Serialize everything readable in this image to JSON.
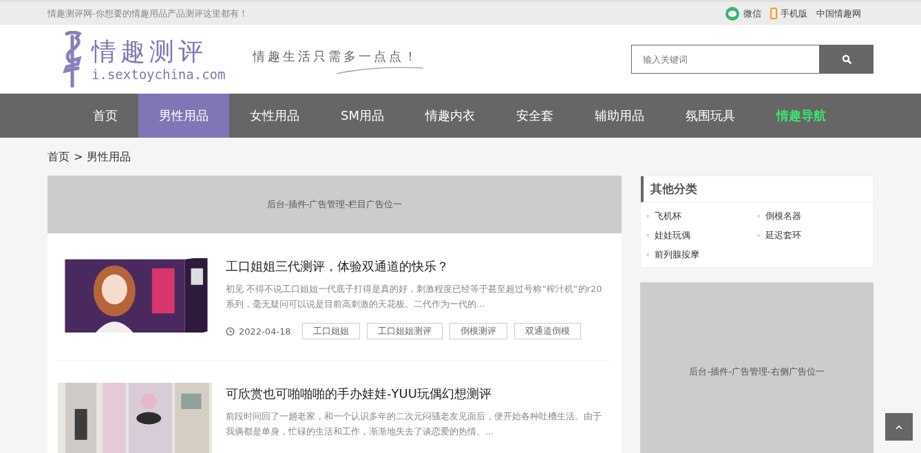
{
  "top_bar": {
    "tagline": "情趣测评网-你想要的情趣用品产品测评这里都有！",
    "links": [
      {
        "kind": "wechat",
        "label": "微信"
      },
      {
        "kind": "mobile",
        "label": "手机版"
      },
      {
        "kind": "plain",
        "label": "中国情趣网"
      }
    ]
  },
  "header": {
    "logo_title": "情趣测评",
    "logo_domain": "i.sextoychina.com",
    "slogan": "情趣生活只需多一点点！",
    "search": {
      "placeholder": "输入关键词"
    }
  },
  "nav": [
    {
      "label": "首页",
      "selected": false,
      "kind": "normal"
    },
    {
      "label": "男性用品",
      "selected": true,
      "kind": "normal"
    },
    {
      "label": "女性用品",
      "selected": false,
      "kind": "normal"
    },
    {
      "label": "SM用品",
      "selected": false,
      "kind": "normal"
    },
    {
      "label": "情趣内衣",
      "selected": false,
      "kind": "normal"
    },
    {
      "label": "安全套",
      "selected": false,
      "kind": "normal"
    },
    {
      "label": "辅助用品",
      "selected": false,
      "kind": "normal"
    },
    {
      "label": "氛围玩具",
      "selected": false,
      "kind": "normal"
    },
    {
      "label": "情趣导航",
      "selected": false,
      "kind": "highlight"
    }
  ],
  "breadcrumb": [
    "首页",
    "男性用品"
  ],
  "breadcrumb_separator": ">",
  "column_ad": "后台-插件-广告管理-栏目广告位一",
  "posts": [
    {
      "title": "工口姐姐三代测评，体验双通道的快乐？",
      "excerpt": "初见 不得不说工口姐姐一代底子打得是真的好，刺激程度已经等于甚至超过号称“榨汁机”的r20系列，毫无疑问可以说是目前高刺激的天花板。二代作为一代的...",
      "date": "2022-04-18",
      "tags": [
        "工口姐姐",
        "工口姐姐测评",
        "倒模测评",
        "双通道倒模"
      ]
    },
    {
      "title": "可欣赏也可啪啪啪的手办娃娃-YUU玩偶幻想测评",
      "excerpt": "前段时间回了一趟老家，和一个认识多年的二次元闷骚老友见面后，便开始各种吐槽生活。由于我俩都是单身，忙碌的生活和工作，渐渐地失去了谈恋爱的热情。..."
    }
  ],
  "sidebar": {
    "category_title": "其他分类",
    "categories": [
      "飞机杯",
      "倒模名器",
      "娃娃玩偶",
      "延迟套环",
      "前列腺按摩"
    ],
    "ad": "后台-插件-广告管理-右侧广告位一"
  }
}
